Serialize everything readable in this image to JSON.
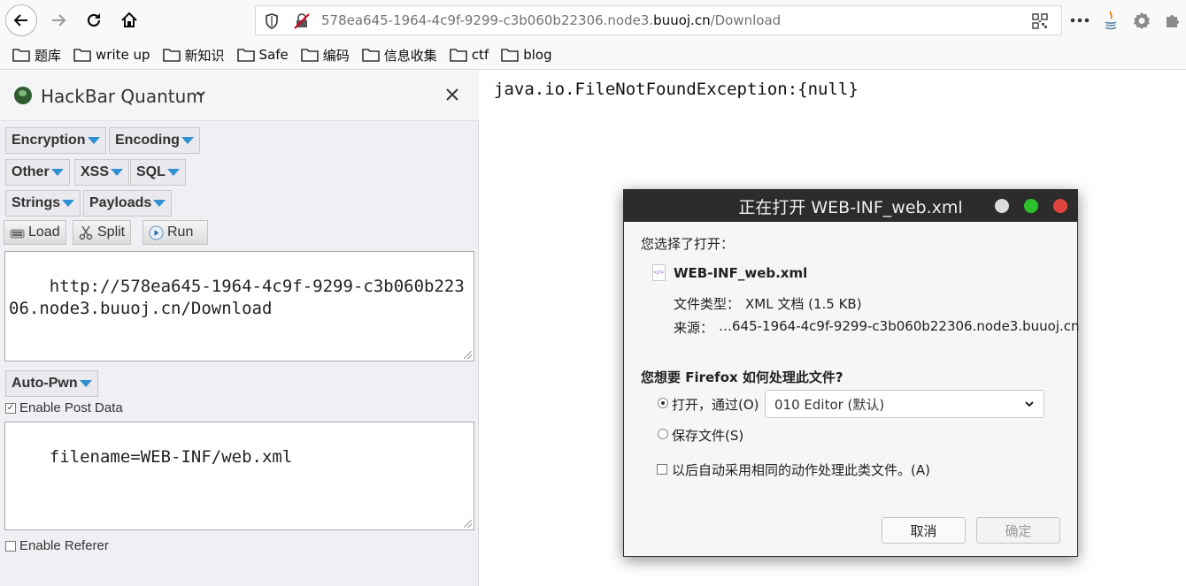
{
  "browser": {
    "url_prefix": "578ea645-1964-4c9f-9299-c3b060b22306.node3.",
    "url_domain": "buuoj.cn",
    "url_path": "/Download"
  },
  "bookmarks": [
    "题库",
    "write up",
    "新知识",
    "Safe",
    "编码",
    "信息收集",
    "ctf",
    "blog"
  ],
  "hackbar": {
    "title": "HackBar Quantum",
    "menus": {
      "encryption": "Encryption",
      "encoding": "Encoding",
      "other": "Other",
      "xss": "XSS",
      "sql": "SQL",
      "strings": "Strings",
      "payloads": "Payloads",
      "autopwn": "Auto-Pwn"
    },
    "tools": {
      "load": "Load",
      "split": "Split",
      "run": "Run"
    },
    "url_value": "http://578ea645-1964-4c9f-9299-c3b060b22306.node3.buuoj.cn/Download",
    "post_label": "Enable Post Data",
    "post_value": "filename=WEB-INF/web.xml",
    "referer_label": "Enable Referer"
  },
  "page": {
    "exception": "java.io.FileNotFoundException:{null}"
  },
  "dialog": {
    "title": "正在打开 WEB-INF_web.xml",
    "chosen_label": "您选择了打开：",
    "filename": "WEB-INF_web.xml",
    "type_label": "文件类型：",
    "type_value": "XML 文档 (1.5 KB)",
    "source_label": "来源：",
    "source_value": "…645-1964-4c9f-9299-c3b060b22306.node3.buuoj.cn",
    "question": "您想要 Firefox 如何处理此文件?",
    "open_with": "打开，通过(O)",
    "app": "010 Editor (默认)",
    "save_file": "保存文件(S)",
    "auto_action": "以后自动采用相同的动作处理此类文件。(A)",
    "cancel": "取消",
    "ok": "确定"
  }
}
